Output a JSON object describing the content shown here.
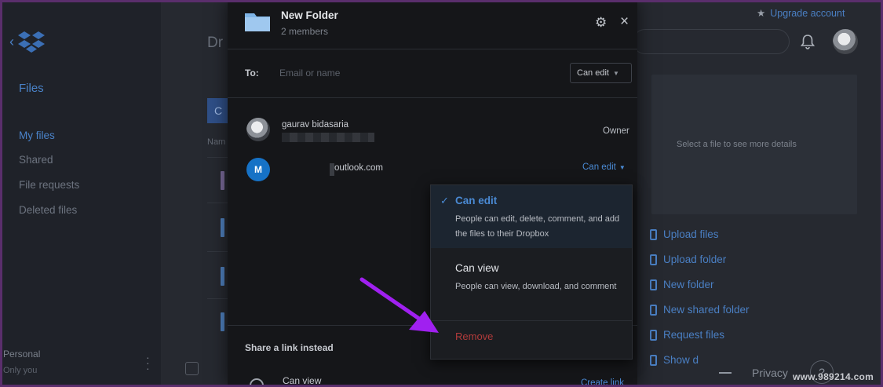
{
  "background_app": {
    "sidebar": {
      "heading": "Files",
      "items": [
        "My files",
        "Shared",
        "File requests",
        "Deleted files"
      ],
      "active_item": "My files",
      "account_name": "Personal",
      "account_sub": "Only you"
    },
    "main": {
      "title": "Dr",
      "create_label": "C",
      "name_column": "Nam"
    },
    "right": {
      "upgrade_label": "Upgrade account",
      "details_hint": "Select a file to see more details",
      "actions": [
        "Upload files",
        "Upload folder",
        "New folder",
        "New shared folder",
        "Request files",
        "Show d"
      ],
      "privacy_label": "Privacy",
      "help_label": "?"
    }
  },
  "share_modal": {
    "folder_name": "New Folder",
    "member_count": "2 members",
    "to_label": "To:",
    "to_placeholder": "Email or name",
    "default_permission": "Can edit",
    "members": [
      {
        "name": "gaurav bidasaria",
        "email_redacted": true,
        "role": "Owner",
        "avatar": "photo"
      },
      {
        "initial": "M",
        "email": "outlook.com",
        "role": "Can edit"
      }
    ],
    "share_link_heading": "Share a link instead",
    "link_permission": "Can view",
    "create_link_label": "Create link"
  },
  "permission_dropdown": {
    "options": [
      {
        "label": "Can edit",
        "description": "People can edit, delete, comment, and add the files to their Dropbox",
        "selected": true
      },
      {
        "label": "Can view",
        "description": "People can view, download, and comment",
        "selected": false
      }
    ],
    "remove_label": "Remove"
  },
  "annotation": {
    "arrow_color": "#a020f0"
  },
  "watermark": "www.989214.com",
  "colors": {
    "accent": "#4a8ad4",
    "danger": "#b13b3b",
    "modal_bg": "#151619"
  }
}
